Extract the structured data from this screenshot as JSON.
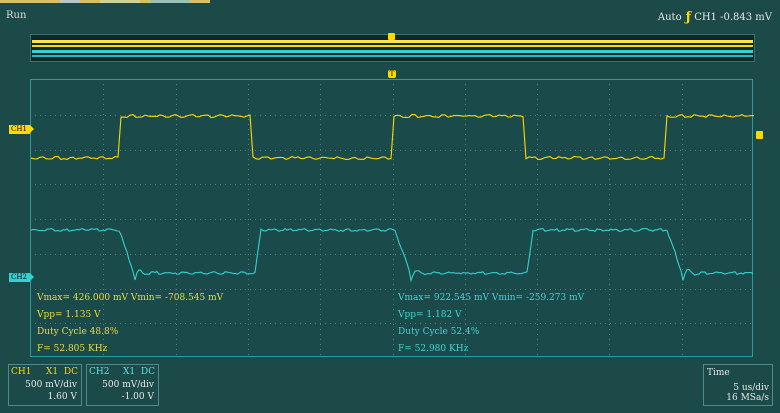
{
  "status": {
    "run_state": "Run"
  },
  "trigger": {
    "mode": "Auto",
    "source": "CH1",
    "level": "-0.843 mV",
    "slope_icon": "rising-edge-icon"
  },
  "measurements": {
    "ch1": {
      "vmax_vmin": "Vmax= 426.000 mV  Vmin= -708.545 mV",
      "vpp": "Vpp= 1.135 V",
      "duty": "Duty Cycle 48.8%",
      "freq": "F= 52.805 KHz"
    },
    "ch2": {
      "vmax_vmin": "Vmax= 922.545 mV  Vmin= -259.273 mV",
      "vpp": "Vpp= 1.182 V",
      "duty": "Duty Cycle 52.4%",
      "freq": "F= 52.980 KHz"
    }
  },
  "channels": [
    {
      "name": "CH1",
      "probe": "X1",
      "coupling": "DC",
      "scale": "500 mV/div",
      "offset": "1.60 V",
      "color": "#ffd800"
    },
    {
      "name": "CH2",
      "probe": "X1",
      "coupling": "DC",
      "scale": "500 mV/div",
      "offset": "-1.00 V",
      "color": "#33d1d1"
    }
  ],
  "timebase": {
    "label": "Time",
    "scale": "5 us/div",
    "sample_rate": "16 MSa/s"
  },
  "markers": {
    "ch1": "CH1",
    "ch2": "CH2",
    "trigger": "T"
  },
  "colors": {
    "background": "#1b4a49",
    "ch1": "#ffd800",
    "ch2": "#33d1d1",
    "grid": "#4d8080"
  }
}
